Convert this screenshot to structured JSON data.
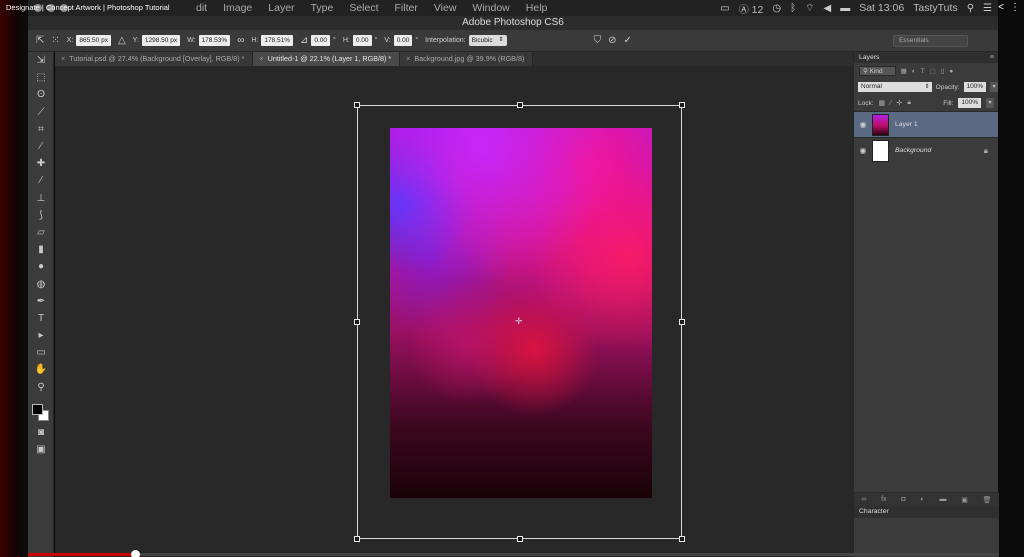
{
  "video": {
    "title": "Designate | Concept Artwork | Photoshop Tutorial",
    "progress_fraction": 0.112
  },
  "menubar": {
    "items": [
      "dit",
      "Image",
      "Layer",
      "Type",
      "Select",
      "Filter",
      "View",
      "Window",
      "Help"
    ],
    "tray": {
      "flag_count": "12",
      "clock": "Sat 13:06",
      "user": "TastyTuts"
    }
  },
  "app": {
    "title": "Adobe Photoshop CS6"
  },
  "options_bar": {
    "x_label": "X:",
    "x_value": "865.50 px",
    "y_label": "Y:",
    "y_value": "1298.50 px",
    "w_label": "W:",
    "w_value": "178.53%",
    "h_label": "H:",
    "h_value": "178.51%",
    "angle_value": "0.00",
    "degree_symbol": "°",
    "hskew_label": "H:",
    "hskew_value": "0.00",
    "vskew_label": "V:",
    "vskew_value": "0.00",
    "interpolation_label": "Interpolation:",
    "interpolation_value": "Bicubic",
    "workspace": "Essentials"
  },
  "tabs": [
    {
      "label": "Tutorial.psd @ 27.4% (Background [Overlay], RGB/8) *",
      "active": false
    },
    {
      "label": "Untitled-1 @ 22.1% (Layer 1, RGB/8) *",
      "active": true
    },
    {
      "label": "Background.jpg @ 39.9% (RGB/8)",
      "active": false
    }
  ],
  "tools": [
    "move-icon",
    "marquee-icon",
    "lasso-icon",
    "quick-select-icon",
    "crop-icon",
    "eyedropper-icon",
    "healing-icon",
    "brush-icon",
    "stamp-icon",
    "history-brush-icon",
    "eraser-icon",
    "gradient-icon",
    "blur-icon",
    "dodge-icon",
    "pen-icon",
    "type-icon",
    "path-select-icon",
    "shape-icon",
    "hand-icon",
    "zoom-icon"
  ],
  "tool_glyphs": [
    "⇲",
    "⬚",
    "ʘ",
    "⟋",
    "⌗",
    "⁄",
    "✚",
    "∕",
    "⊥",
    "⟆",
    "▱",
    "▮",
    "●",
    "◍",
    "✒",
    "T",
    "▸",
    "▭",
    "✋",
    "⚲"
  ],
  "colors": {
    "foreground": "#000000",
    "background": "#ffffff"
  },
  "layers_panel": {
    "title": "Layers",
    "kind_label": "Kind",
    "blend_mode": "Normal",
    "opacity_label": "Opacity:",
    "opacity_value": "100%",
    "lock_label": "Lock:",
    "fill_label": "Fill:",
    "fill_value": "100%",
    "layers": [
      {
        "name": "Layer 1",
        "selected": true
      },
      {
        "name": "Background",
        "selected": false,
        "locked": true
      }
    ]
  },
  "character_panel": {
    "title": "Character"
  }
}
